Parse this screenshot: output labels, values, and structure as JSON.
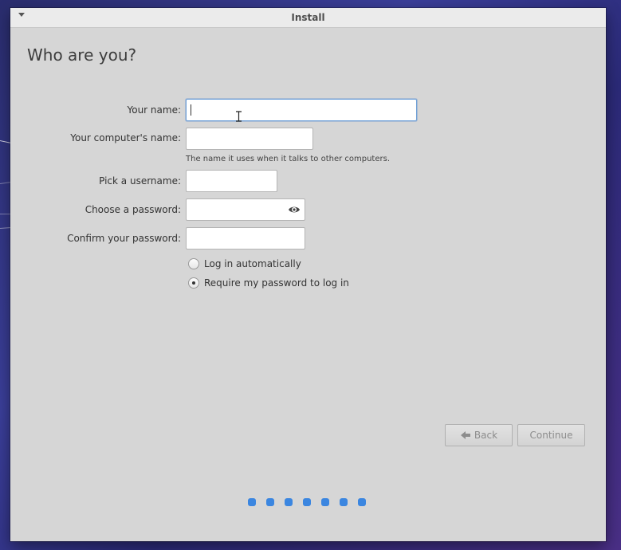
{
  "window": {
    "title": "Install"
  },
  "page": {
    "heading": "Who are you?"
  },
  "form": {
    "your_name": {
      "label": "Your name:",
      "value": ""
    },
    "computer_name": {
      "label": "Your computer's name:",
      "value": "",
      "hint": "The name it uses when it talks to other computers."
    },
    "username": {
      "label": "Pick a username:",
      "value": ""
    },
    "password": {
      "label": "Choose a password:",
      "value": ""
    },
    "confirm_password": {
      "label": "Confirm your password:",
      "value": ""
    },
    "login_options": [
      {
        "label": "Log in automatically",
        "selected": false
      },
      {
        "label": "Require my password to log in",
        "selected": true
      }
    ]
  },
  "buttons": {
    "back": "Back",
    "continue": "Continue"
  },
  "progress": {
    "total_steps": 7,
    "dot_color": "#3b86e0"
  },
  "icons": {
    "menu": "chevron-down-icon",
    "show_password": "eye-icon",
    "back": "arrow-left-icon"
  }
}
